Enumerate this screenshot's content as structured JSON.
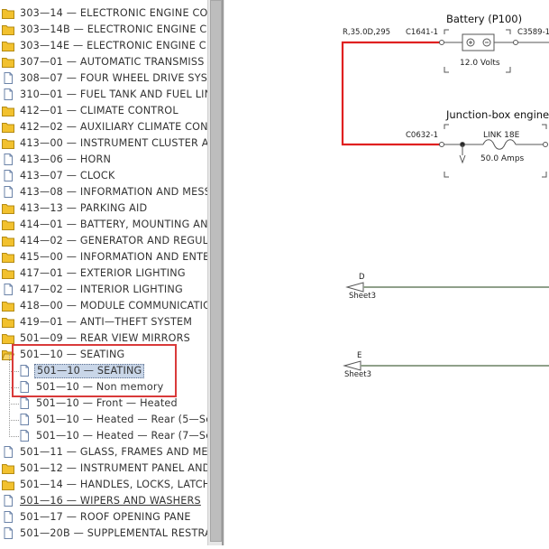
{
  "tree": {
    "items": [
      {
        "label": "303—14 — ELECTRONIC ENGINE CO",
        "type": "folder"
      },
      {
        "label": "303—14B — ELECTRONIC ENGINE C",
        "type": "folder"
      },
      {
        "label": "303—14E — ELECTRONIC ENGINE C",
        "type": "folder"
      },
      {
        "label": "307—01 — AUTOMATIC TRANSMISS",
        "type": "folder"
      },
      {
        "label": "308—07 — FOUR WHEEL DRIVE SYS",
        "type": "doc"
      },
      {
        "label": "310—01 — FUEL TANK AND FUEL LIN",
        "type": "doc"
      },
      {
        "label": "412—01 — CLIMATE CONTROL",
        "type": "folder"
      },
      {
        "label": "412—02 — AUXILIARY CLIMATE CON",
        "type": "folder"
      },
      {
        "label": "413—00 — INSTRUMENT CLUSTER A",
        "type": "folder"
      },
      {
        "label": "413—06 — HORN",
        "type": "doc"
      },
      {
        "label": "413—07 — CLOCK",
        "type": "doc"
      },
      {
        "label": "413—08 — INFORMATION AND MESS",
        "type": "doc"
      },
      {
        "label": "413—13 — PARKING AID",
        "type": "folder"
      },
      {
        "label": "414—01 — BATTERY, MOUNTING AN",
        "type": "folder"
      },
      {
        "label": "414—02 — GENERATOR AND REGUL",
        "type": "folder"
      },
      {
        "label": "415—00 — INFORMATION AND ENTE",
        "type": "folder"
      },
      {
        "label": "417—01 — EXTERIOR LIGHTING",
        "type": "folder"
      },
      {
        "label": "417—02 — INTERIOR LIGHTING",
        "type": "doc"
      },
      {
        "label": "418—00 — MODULE COMMUNICATIC",
        "type": "folder"
      },
      {
        "label": "419—01 — ANTI—THEFT SYSTEM",
        "type": "folder"
      },
      {
        "label": "501—09 — REAR VIEW MIRRORS",
        "type": "folder"
      },
      {
        "label": "501—10 — SEATING",
        "type": "folder-open"
      },
      {
        "label": "501—10 — SEATING",
        "type": "child",
        "selected": true
      },
      {
        "label": "501—10 — Non memory",
        "type": "child"
      },
      {
        "label": "501—10 — Front — Heated",
        "type": "child"
      },
      {
        "label": "501—10 — Heated — Rear (5—Se",
        "type": "child"
      },
      {
        "label": "501—10 — Heated — Rear (7—Se",
        "type": "child"
      },
      {
        "label": "501—11 — GLASS, FRAMES AND ME",
        "type": "doc"
      },
      {
        "label": "501—12 — INSTRUMENT PANEL AND",
        "type": "folder"
      },
      {
        "label": "501—14 — HANDLES, LOCKS, LATCH",
        "type": "folder"
      },
      {
        "label": "501—16 — WIPERS AND WASHERS",
        "type": "doc",
        "underline": true
      },
      {
        "label": "501—17 — ROOF OPENING PANE",
        "type": "doc"
      },
      {
        "label": "501—20B — SUPPLEMENTAL RESTRA",
        "type": "doc"
      }
    ]
  },
  "diagram": {
    "battery_title": "Battery (P100)",
    "battery_value": "12.0 Volts",
    "wire_label": "R,35.0D,295",
    "conn_c1641": "C1641-1",
    "conn_c3589": "C3589-1",
    "junction_title": "Junction-box engine",
    "link_label": "LINK 18E",
    "link_value": "50.0 Amps",
    "conn_c0632": "C0632-1",
    "ref_d_letter": "D",
    "ref_d_sheet": "Sheet3",
    "ref_e_letter": "E",
    "ref_e_sheet": "Sheet3"
  },
  "colors": {
    "wire_red": "#e02020",
    "wire_green": "#8fa08a",
    "highlight": "#d93a3a",
    "folder": "#f2c12e",
    "selection": "#c9d6e8"
  }
}
